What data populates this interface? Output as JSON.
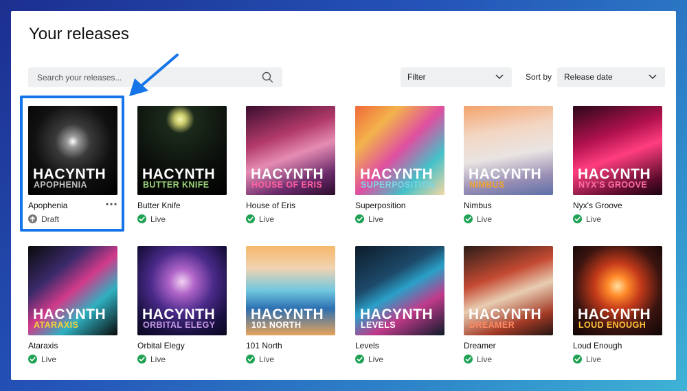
{
  "page": {
    "title": "Your releases"
  },
  "search": {
    "placeholder": "Search your releases..."
  },
  "filter": {
    "label": "Filter"
  },
  "sort": {
    "label": "Sort by",
    "value": "Release date"
  },
  "colors": {
    "accent": "#1575e8",
    "live": "#1fa254",
    "draft": "#7a7a7a"
  },
  "releases": [
    {
      "name": "Apophenia",
      "brand": "HACYNTH",
      "subtitle": "APOPHENIA",
      "status": "Draft",
      "status_icon": "upload-icon"
    },
    {
      "name": "Butter Knife",
      "brand": "HACYNTH",
      "subtitle": "BUTTER KNIFE",
      "status": "Live",
      "status_icon": "check-circle-icon"
    },
    {
      "name": "House of Eris",
      "brand": "HACYNTH",
      "subtitle": "HOUSE OF ERIS",
      "status": "Live",
      "status_icon": "check-circle-icon"
    },
    {
      "name": "Superposition",
      "brand": "HACYNTH",
      "subtitle": "SUPERPOSITION",
      "status": "Live",
      "status_icon": "check-circle-icon"
    },
    {
      "name": "Nimbus",
      "brand": "HACYNTH",
      "subtitle": "NIMBUS",
      "status": "Live",
      "status_icon": "check-circle-icon"
    },
    {
      "name": "Nyx's Groove",
      "brand": "HACYNTH",
      "subtitle": "NYX'S GROOVE",
      "status": "Live",
      "status_icon": "check-circle-icon"
    },
    {
      "name": "Ataraxis",
      "brand": "HACYNTH",
      "subtitle": "ATARAXIS",
      "status": "Live",
      "status_icon": "check-circle-icon"
    },
    {
      "name": "Orbital Elegy",
      "brand": "HACYNTH",
      "subtitle": "ORBITAL ELEGY",
      "status": "Live",
      "status_icon": "check-circle-icon"
    },
    {
      "name": "101 North",
      "brand": "HACYNTH",
      "subtitle": "101 NORTH",
      "status": "Live",
      "status_icon": "check-circle-icon"
    },
    {
      "name": "Levels",
      "brand": "HACYNTH",
      "subtitle": "LEVELS",
      "status": "Live",
      "status_icon": "check-circle-icon"
    },
    {
      "name": "Dreamer",
      "brand": "HACYNTH",
      "subtitle": "DREAMER",
      "status": "Live",
      "status_icon": "check-circle-icon"
    },
    {
      "name": "Loud Enough",
      "brand": "HACYNTH",
      "subtitle": "LOUD ENOUGH",
      "status": "Live",
      "status_icon": "check-circle-icon"
    }
  ]
}
